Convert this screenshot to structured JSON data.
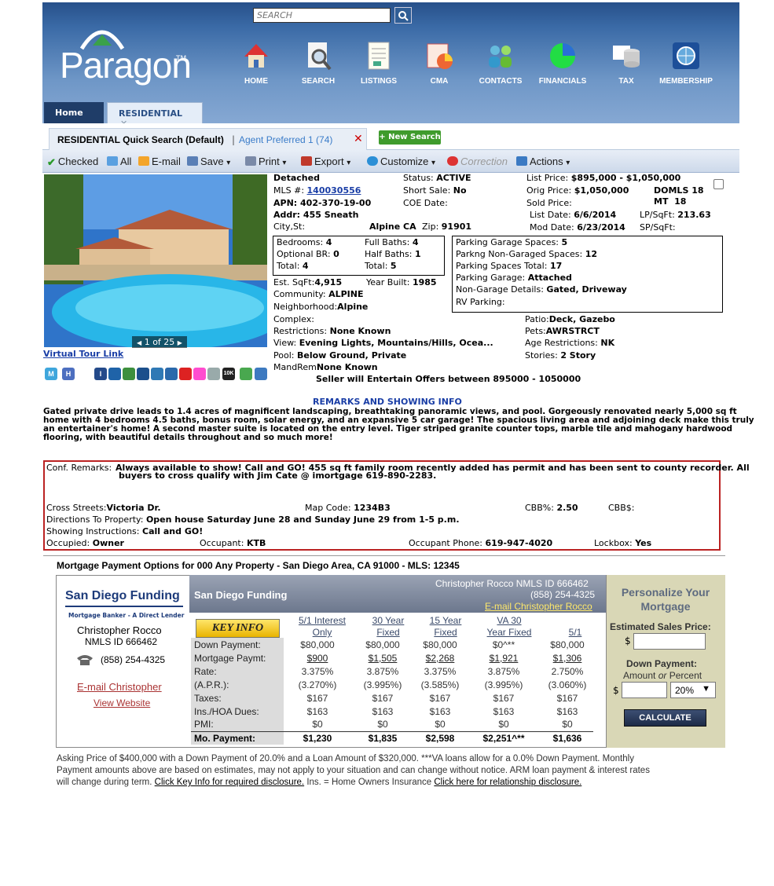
{
  "search": {
    "placeholder": "SEARCH"
  },
  "logo": {
    "name": "Paragon",
    "tm": "TM"
  },
  "nav": [
    "HOME",
    "SEARCH",
    "LISTINGS",
    "CMA",
    "CONTACTS",
    "FINANCIALS",
    "TAX",
    "MEMBERSHIP"
  ],
  "tabs": {
    "home": "Home",
    "residential": "RESIDENTIAL",
    "close": "✕"
  },
  "subtabs": {
    "quick": "RESIDENTIAL Quick Search (Default)",
    "sep": "|",
    "agent": "Agent Preferred 1 (74)",
    "close": "✕",
    "new_search": "+ New Search"
  },
  "toolbar": {
    "checked": "Checked",
    "all": "All",
    "email": "E-mail",
    "save": "Save",
    "print": "Print",
    "export": "Export",
    "customize": "Customize",
    "correction": "Correction",
    "actions": "Actions",
    "caret": "▾"
  },
  "photo": {
    "counter": "1 of 25",
    "prev": "◀",
    "next": "▶",
    "virtual_tour": "Virtual Tour Link"
  },
  "listing": {
    "type": "Detached",
    "mls_label": "MLS #:",
    "mls": "140030556",
    "apn": "APN: 402-370-19-00",
    "addr": "Addr: 455 Sneath",
    "city_label": "City,St:",
    "city": "Alpine  CA",
    "zip_label": "Zip:",
    "zip": "91901",
    "status_label": "Status:",
    "status": "ACTIVE",
    "short_sale_label": "Short Sale:",
    "short_sale": "No",
    "coe_label": "COE Date:",
    "list_price_label": "List Price:",
    "list_price": "$895,000 - $1,050,000",
    "orig_price_label": "Orig Price:",
    "orig_price": "$1,050,000",
    "sold_price_label": "Sold Price:",
    "list_date_label": "List Date:",
    "list_date": "6/6/2014",
    "mod_date_label": "Mod Date:",
    "mod_date": "6/23/2014",
    "doml_label": "DOMLS",
    "doml": "18",
    "mt_label": "MT",
    "mt": "18",
    "lp_sqft_label": "LP/SqFt:",
    "lp_sqft": "213.63",
    "sp_sqft_label": "SP/SqFt:",
    "bed_label": "Bedrooms:",
    "bed": "4",
    "opt_br_label": "Optional BR:",
    "opt_br": "0",
    "total_label": "Total:",
    "total_rooms": "4",
    "full_baths_label": "Full Baths:",
    "full_baths": "4",
    "half_baths_label": "Half Baths:",
    "half_baths": "1",
    "total_baths": "5",
    "parking_garage_spaces": "Parking Garage Spaces:",
    "pgs": "5",
    "parking_nongarage": "Parkng Non-Garaged Spaces:",
    "pngs": "12",
    "parking_total": "Parking Spaces Total:",
    "pst": "17",
    "parking_garage": "Parking Garage:",
    "pg": "Attached",
    "nongarage_details": "Non-Garage Details:",
    "ngd": "Gated, Driveway",
    "rv_parking": "RV Parking:",
    "sqft_label": "Est. SqFt:",
    "sqft": "4,915",
    "year_built_label": "Year Built:",
    "year_built": "1985",
    "community_label": "Community:",
    "community": "ALPINE",
    "neighborhood_label": "Neighborhood:",
    "neighborhood": "Alpine",
    "complex_label": "Complex:",
    "restrictions_label": "Restrictions:",
    "restrictions": "None Known",
    "view_label": "View:",
    "view": "Evening Lights, Mountains/Hills, Ocea...",
    "pool_label": "Pool:",
    "pool": "Below Ground, Private",
    "mandrem_label": "MandRem",
    "mandrem": "None Known",
    "patio_label": "Patio:",
    "patio": "Deck, Gazebo",
    "pets_label": "Pets:",
    "pets": "AWRSTRCT",
    "age_label": "Age Restrictions:",
    "age": "NK",
    "stories_label": "Stories:",
    "stories": "2 Story",
    "offers": "Seller will Entertain Offers between 895000 - 1050000"
  },
  "feature_icons": [
    "M",
    "H",
    "I",
    "",
    "",
    "",
    "",
    "",
    "",
    "",
    "10K",
    "",
    ""
  ],
  "remarks": {
    "title": "REMARKS AND SHOWING INFO",
    "l1": "Gated private drive leads to 1.4 acres of magnificent landscaping, breathtaking panoramic views, and pool. Gorgeously renovated nearly 5,000 sq ft",
    "l2": "home with 4 bedrooms 4.5 baths, bonus room, solar energy, and an expansive 5 car garage! The spacious living area and adjoining deck make this truly",
    "l3": "an entertainer's home! A second master suite is located on the entry level. Tiger striped granite counter tops, marble tile and mahogany hardwood",
    "l4": "flooring, with beautiful details throughout and so much more!"
  },
  "conf": {
    "label": "Conf. Remarks:",
    "l1": "Always available to show! Call and GO! 455 sq ft family room recently added has permit and has been sent to county recorder. All",
    "l2": "buyers to cross qualify with Jim Cate @ imortgage 619-890-2283.",
    "cross_label": "Cross Streets:",
    "cross": "Victoria Dr.",
    "map_label": "Map Code:",
    "map": "1234B3",
    "cbb_label": "CBB%:",
    "cbb": "2.50",
    "cbbd_label": "CBB$:",
    "dir_label": "Directions To Property:",
    "dir": "Open house Saturday June 28 and Sunday June 29 from 1-5 p.m.",
    "show_label": "Showing Instructions:",
    "show": "Call and GO!",
    "occ_label": "Occupied:",
    "occ": "Owner",
    "occupant_label": "Occupant:",
    "occupant": "KTB",
    "phone_label": "Occupant Phone:",
    "phone": "619-947-4020",
    "lockbox_label": "Lockbox:",
    "lockbox": "Yes"
  },
  "mortgage": {
    "title": "Mortgage Payment Options for 000 Any Property - San Diego Area, CA 91000 - MLS: 12345",
    "company": "San Diego Funding",
    "tagline": "Mortgage Banker - A Direct Lender",
    "agent": "Christopher Rocco",
    "nmls": "NMLS ID 666462",
    "phone": "(858) 254-4325",
    "email_link": "E-mail Christopher",
    "website_link": "View Website",
    "hdr_company": "San Diego Funding",
    "hdr_agent": "Christopher Rocco NMLS ID 666462",
    "hdr_phone": "(858) 254-4325",
    "hdr_email": "E-mail Christopher Rocco",
    "key_info": "KEY INFO",
    "cols": [
      [
        "5/1 Interest",
        "Only"
      ],
      [
        "30 Year",
        "Fixed"
      ],
      [
        "15 Year",
        "Fixed"
      ],
      [
        "VA 30",
        "Year Fixed"
      ],
      [
        "",
        "5/1"
      ]
    ],
    "rows": [
      {
        "label": "Down Payment:",
        "vals": [
          "$80,000",
          "$80,000",
          "$80,000",
          "$0^**",
          "$80,000"
        ]
      },
      {
        "label": "Mortgage Paymt:",
        "vals": [
          "$900",
          "$1,505",
          "$2,268",
          "$1,921",
          "$1,306"
        ]
      },
      {
        "label": "Rate:",
        "vals": [
          "3.375%",
          "3.875%",
          "3.375%",
          "3.875%",
          "2.750%"
        ]
      },
      {
        "label": "(A.P.R.):",
        "vals": [
          "(3.270%)",
          "(3.995%)",
          "(3.585%)",
          "(3.995%)",
          "(3.060%)"
        ]
      },
      {
        "label": "Taxes:",
        "vals": [
          "$167",
          "$167",
          "$167",
          "$167",
          "$167"
        ]
      },
      {
        "label": "Ins./HOA Dues:",
        "vals": [
          "$163",
          "$163",
          "$163",
          "$163",
          "$163"
        ]
      },
      {
        "label": "PMI:",
        "vals": [
          "$0",
          "$0",
          "$0",
          "$0",
          "$0"
        ]
      },
      {
        "label": "Mo. Payment:",
        "vals": [
          "$1,230",
          "$1,835",
          "$2,598",
          "$2,251^**",
          "$1,636"
        ]
      }
    ],
    "personalize": {
      "title1": "Personalize Your",
      "title2": "Mortgage",
      "est_label": "Estimated Sales Price:",
      "dollar": "$",
      "down_label": "Down Payment:",
      "down_sub1": "Amount",
      "down_sub_or": "or",
      "down_sub2": "Percent",
      "pct": "20%",
      "calc": "CALCULATE"
    },
    "disc1": "Asking Price of $400,000 with a Down Payment of 20.0% and a Loan Amount of $320,000. ***VA loans allow for a 0.0% Down Payment. Monthly",
    "disc2": "Payment amounts above are based on estimates, may not apply to your situation and can change without notice. ARM loan payment & interest rates",
    "disc3a": "will change during term.",
    "disc3b": "Click Key Info for required disclosure.",
    "disc3c": "Ins. = Home Owners Insurance",
    "disc3d": "Click here for relationship disclosure."
  }
}
